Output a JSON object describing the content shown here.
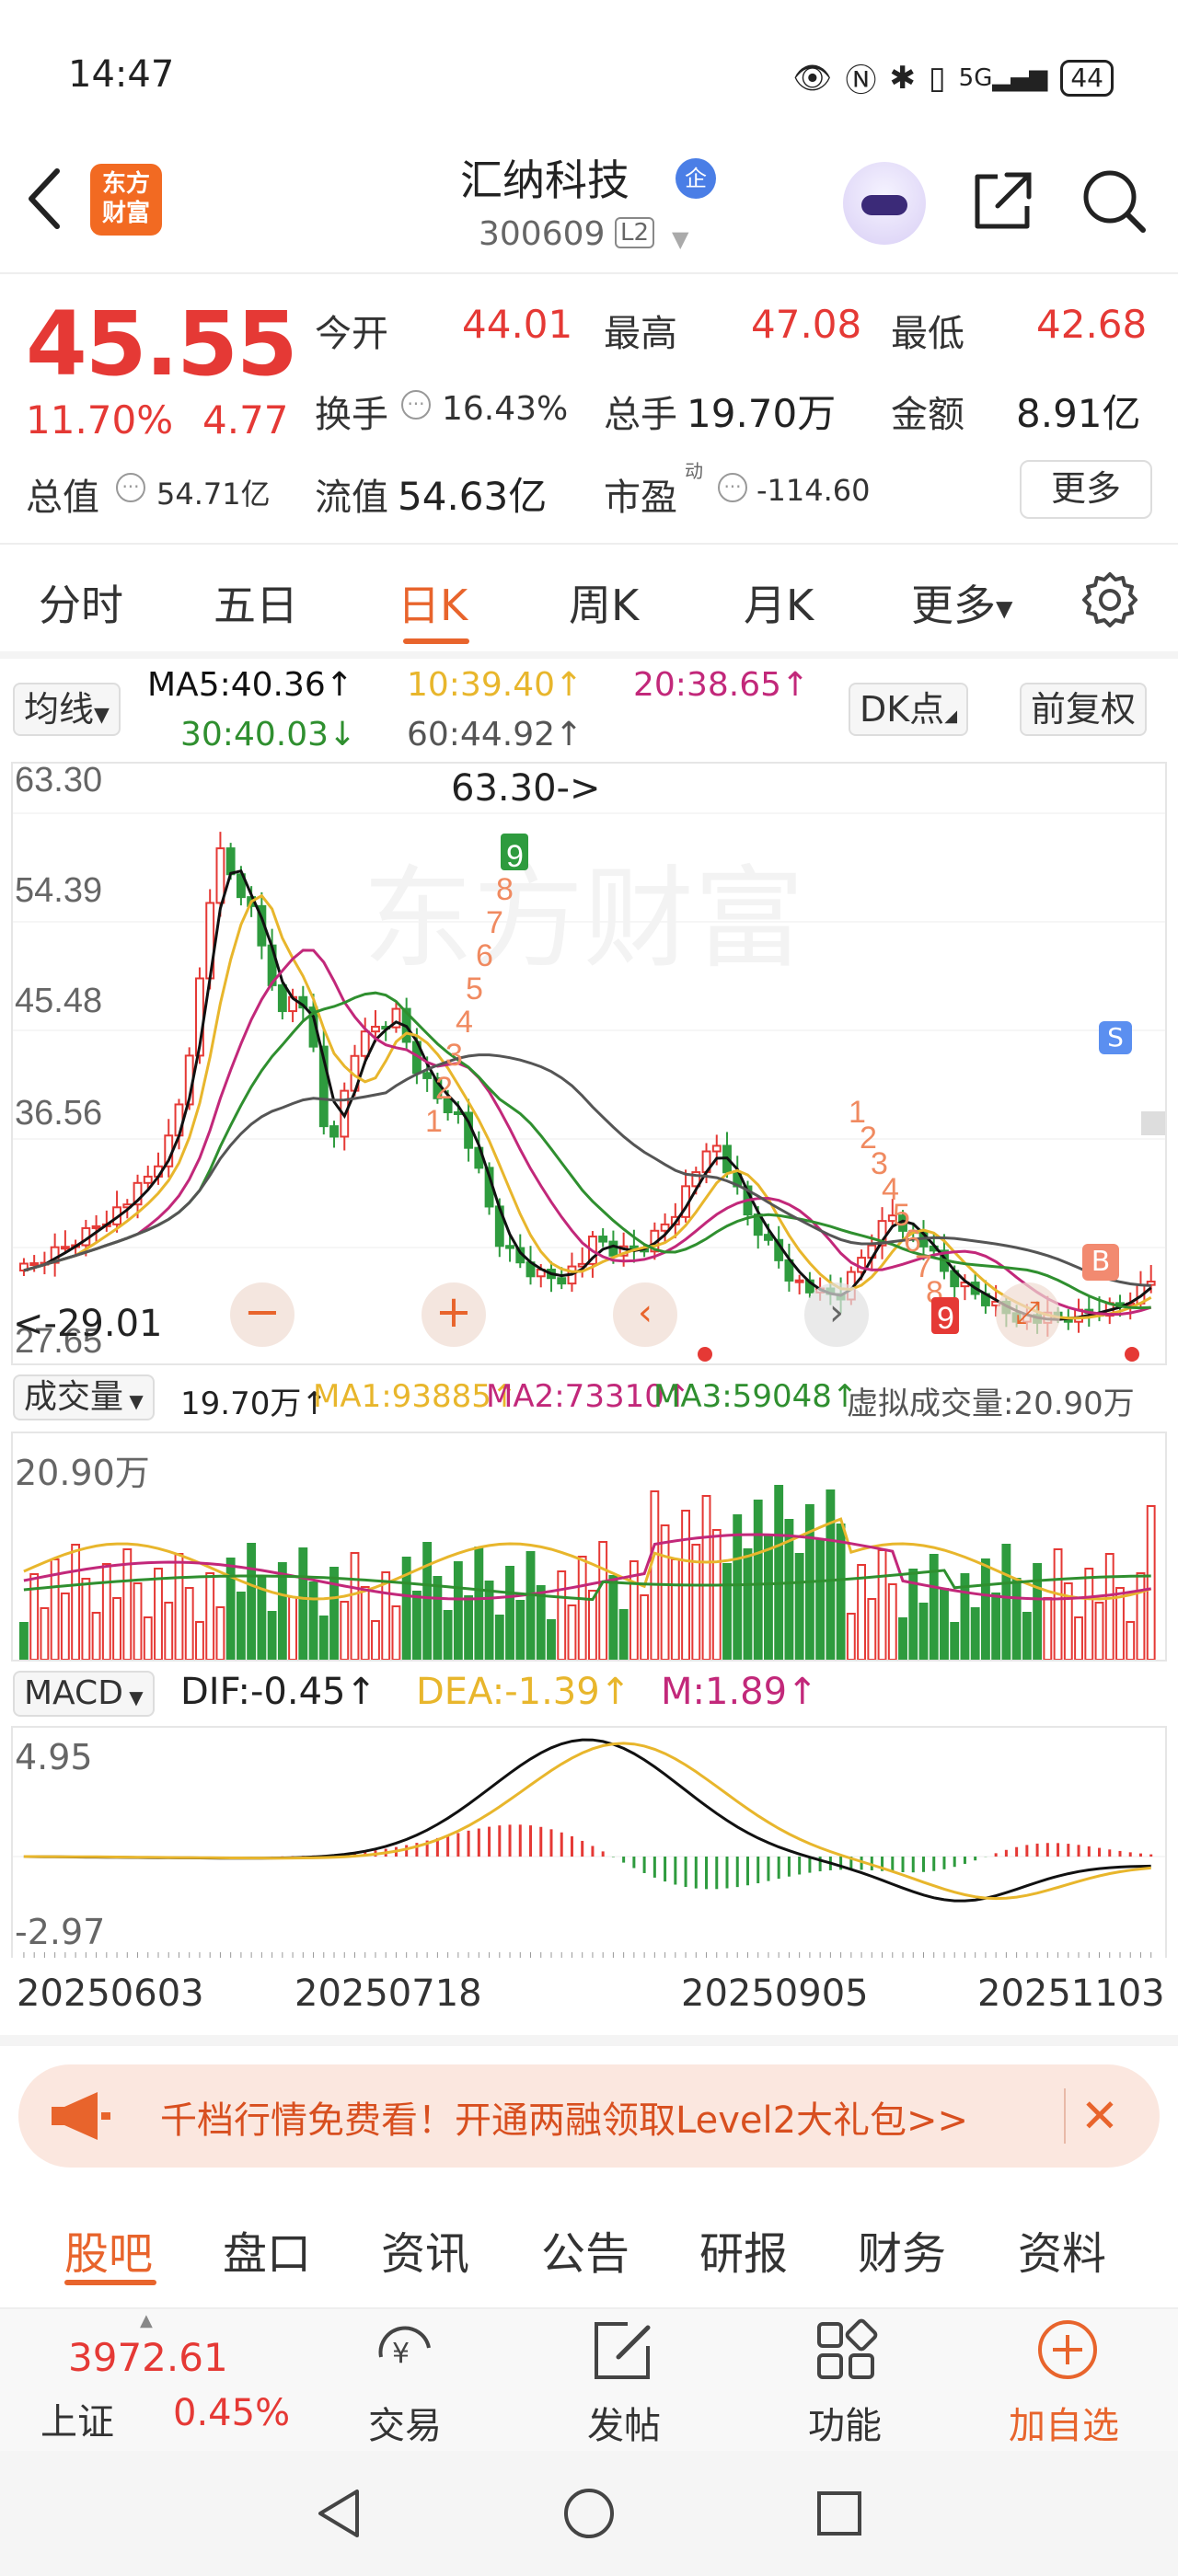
{
  "status_bar": {
    "time": "14:47",
    "net": "5G",
    "battery": "44"
  },
  "header": {
    "brand": "东方财富",
    "stock_name": "汇纳科技",
    "ent_badge": "企",
    "stock_code": "300609",
    "level_badge": "L2"
  },
  "quote": {
    "price": "45.55",
    "change_pct": "11.70%",
    "change_amt": "4.77",
    "open_label": "今开",
    "open": "44.01",
    "high_label": "最高",
    "high": "47.08",
    "low_label": "最低",
    "low": "42.68",
    "turnover_label": "换手",
    "turnover": "16.43%",
    "volume_label": "总手",
    "volume": "19.70万",
    "amount_label": "金额",
    "amount": "8.91亿",
    "mcap_label": "总值",
    "mcap": "54.71亿",
    "float_label": "流值",
    "float": "54.63亿",
    "pe_label": "市盈",
    "pe_sup": "动",
    "pe": "-114.60",
    "more": "更多"
  },
  "period_tabs": [
    "分时",
    "五日",
    "日K",
    "周K",
    "月K",
    "更多"
  ],
  "ma_legend": {
    "selector": "均线",
    "ma5": "MA5:40.36↑",
    "ma10": "10:39.40↑",
    "ma20": "20:38.65↑",
    "ma30": "30:40.03↓",
    "ma60": "60:44.92↑",
    "dk": "DK点",
    "adjust": "前复权"
  },
  "kline": {
    "y_labels": [
      "63.30",
      "54.39",
      "45.48",
      "36.56",
      "27.65"
    ],
    "max_annotation": "63.30->",
    "min_annotation": "<-29.01",
    "td_buy_seq": [
      "1",
      "2",
      "3",
      "4",
      "5",
      "6",
      "7",
      "8",
      "9"
    ],
    "td_sell_seq": [
      "1",
      "2",
      "3",
      "4",
      "5",
      "6",
      "7",
      "8",
      "9"
    ],
    "signal_s": "S",
    "signal_b": "B",
    "colors": {
      "up": "#e53935",
      "down": "#2e9b3e",
      "ma5": "#111111",
      "ma10": "#e8b62c",
      "ma20": "#c2287a",
      "ma30": "#2f8f2f",
      "ma60": "#555555"
    }
  },
  "volume_panel": {
    "selector": "成交量",
    "value": "19.70万↑",
    "ma1": "MA1:93885↑",
    "ma2": "MA2:73310↑",
    "ma3": "MA3:59048↑",
    "virtual": "虚拟成交量:20.90万",
    "y_max": "20.90万"
  },
  "macd_panel": {
    "selector": "MACD",
    "dif": "DIF:-0.45↑",
    "dea": "DEA:-1.39↑",
    "m": "M:1.89↑",
    "y_max": "4.95",
    "y_min": "-2.97"
  },
  "dates": [
    "20250603",
    "20250718",
    "20250905",
    "20251103"
  ],
  "promo": {
    "text": "千档行情免费看！开通两融领取Level2大礼包>>"
  },
  "content_tabs": [
    "股吧",
    "盘口",
    "资讯",
    "公告",
    "研报",
    "财务",
    "资料"
  ],
  "bottom_bar": {
    "index_value": "3972.61",
    "index_name": "上证",
    "index_pct": "0.45%",
    "trade": "交易",
    "post": "发帖",
    "func": "功能",
    "add": "加自选"
  }
}
